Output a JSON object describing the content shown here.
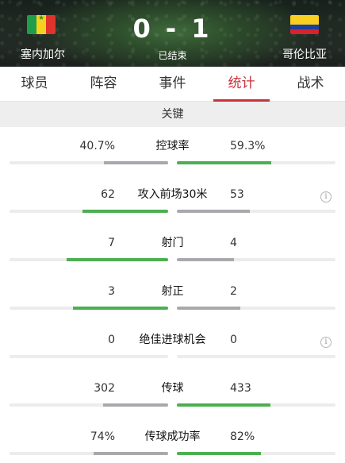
{
  "header": {
    "home_team": "塞内加尔",
    "away_team": "哥伦比亚",
    "score": "0 - 1",
    "status": "已结束",
    "home_flag": "senegal-flag",
    "away_flag": "colombia-flag"
  },
  "tabs": [
    {
      "label": "球员",
      "active": false
    },
    {
      "label": "阵容",
      "active": false
    },
    {
      "label": "事件",
      "active": false
    },
    {
      "label": "统计",
      "active": true
    },
    {
      "label": "战术",
      "active": false
    }
  ],
  "section": {
    "title": "关键"
  },
  "colors": {
    "accent": "#c8323c",
    "leader": "#4caf50",
    "trailer": "#a9a9ad",
    "track": "#ececec"
  },
  "stats": [
    {
      "label": "控球率",
      "home": "40.7%",
      "away": "59.3%",
      "home_share": 0.407,
      "away_share": 0.593,
      "winner": "away",
      "info": false
    },
    {
      "label": "攻入前场30米",
      "home": "62",
      "away": "53",
      "home_share": 0.54,
      "away_share": 0.46,
      "winner": "home",
      "info": true
    },
    {
      "label": "射门",
      "home": "7",
      "away": "4",
      "home_share": 0.64,
      "away_share": 0.36,
      "winner": "home",
      "info": false
    },
    {
      "label": "射正",
      "home": "3",
      "away": "2",
      "home_share": 0.6,
      "away_share": 0.4,
      "winner": "home",
      "info": false
    },
    {
      "label": "绝佳进球机会",
      "home": "0",
      "away": "0",
      "home_share": 0,
      "away_share": 0,
      "winner": "none",
      "info": true
    },
    {
      "label": "传球",
      "home": "302",
      "away": "433",
      "home_share": 0.41,
      "away_share": 0.59,
      "winner": "away",
      "info": false
    },
    {
      "label": "传球成功率",
      "home": "74%",
      "away": "82%",
      "home_share": 0.47,
      "away_share": 0.53,
      "winner": "away",
      "info": false
    }
  ]
}
